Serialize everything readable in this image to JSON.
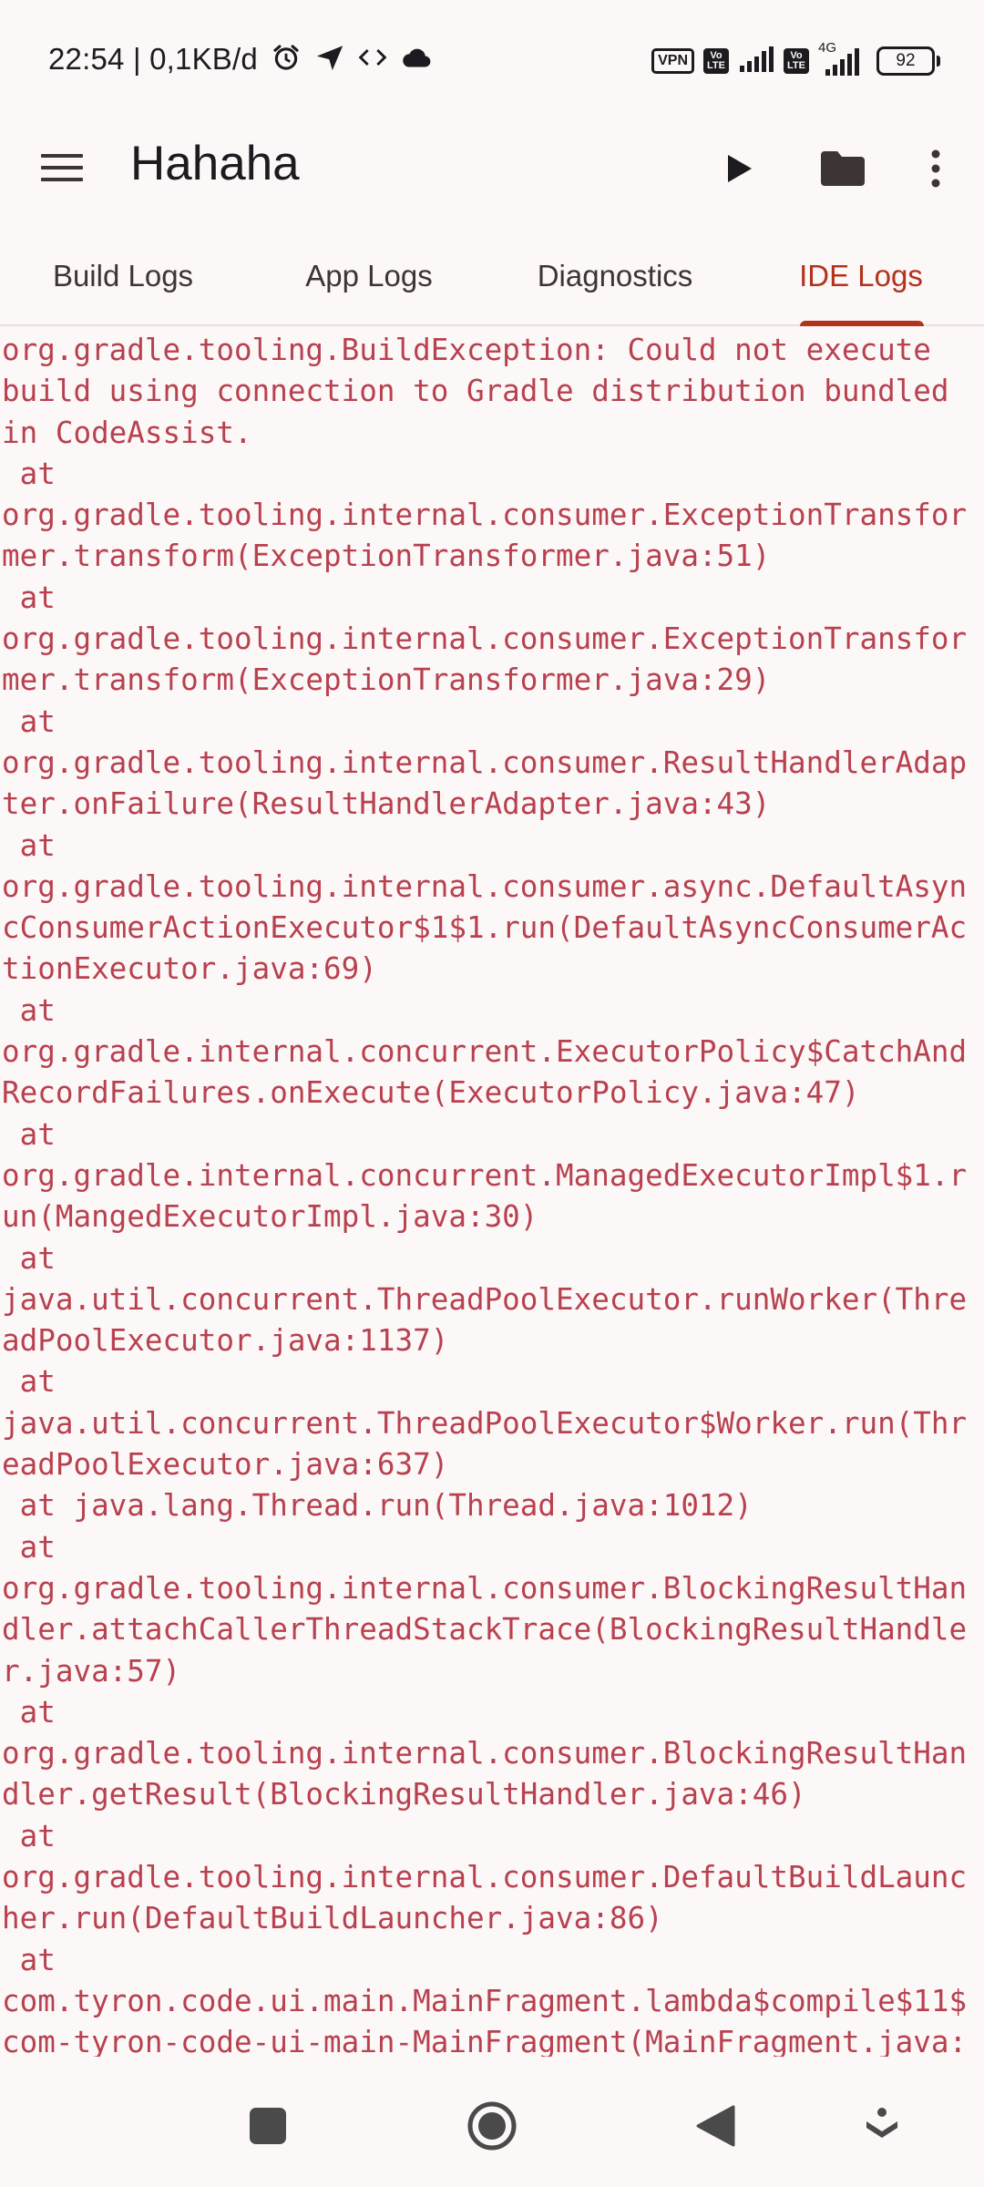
{
  "status_bar": {
    "time_text": "22:54 | 0,1KB/d",
    "vpn_label": "VPN",
    "volte_label": "Vo LTE",
    "network_label": "4G",
    "battery_level": "92"
  },
  "app_bar": {
    "title": "Hahaha"
  },
  "tabs": [
    {
      "label": "Build Logs",
      "active": false
    },
    {
      "label": "App Logs",
      "active": false
    },
    {
      "label": "Diagnostics",
      "active": false
    },
    {
      "label": "IDE Logs",
      "active": true
    }
  ],
  "log": {
    "lines": [
      "org.gradle.tooling.BuildException: Could not execute",
      "build using connection to Gradle distribution bundled",
      "in CodeAssist.",
      " at",
      "org.gradle.tooling.internal.consumer.ExceptionTransfor",
      "mer.transform(ExceptionTransformer.java:51)",
      " at",
      "org.gradle.tooling.internal.consumer.ExceptionTransfor",
      "mer.transform(ExceptionTransformer.java:29)",
      " at",
      "org.gradle.tooling.internal.consumer.ResultHandlerAdap",
      "ter.onFailure(ResultHandlerAdapter.java:43)",
      " at",
      "org.gradle.tooling.internal.consumer.async.DefaultAsyn",
      "cConsumerActionExecutor$1$1.run(DefaultAsyncConsumerAc",
      "tionExecutor.java:69)",
      " at",
      "org.gradle.internal.concurrent.ExecutorPolicy$CatchAnd",
      "RecordFailures.onExecute(ExecutorPolicy.java:47)",
      " at",
      "org.gradle.internal.concurrent.ManagedExecutorImpl$1.r",
      "un(MangedExecutorImpl.java:30)",
      " at",
      "java.util.concurrent.ThreadPoolExecutor.runWorker(Thre",
      "adPoolExecutor.java:1137)",
      " at",
      "java.util.concurrent.ThreadPoolExecutor$Worker.run(Thr",
      "eadPoolExecutor.java:637)",
      " at java.lang.Thread.run(Thread.java:1012)",
      " at",
      "org.gradle.tooling.internal.consumer.BlockingResultHan",
      "dler.attachCallerThreadStackTrace(BlockingResultHandle",
      "r.java:57)",
      " at",
      "org.gradle.tooling.internal.consumer.BlockingResultHan",
      "dler.getResult(BlockingResultHandler.java:46)",
      " at",
      "org.gradle.tooling.internal.consumer.DefaultBuildLaunc",
      "her.run(DefaultBuildLauncher.java:86)",
      " at",
      "com.tyron.code.ui.main.MainFragment.lambda$compile$11$",
      "com-tyron-code-ui-main-MainFragment(MainFragment.java:"
    ]
  },
  "colors": {
    "accent": "#b3321c",
    "log_text": "#b8414f",
    "background": "#fcf8f8",
    "on_surface": "#1c1b1f"
  },
  "icons": {
    "menu": "hamburger-menu-icon",
    "run": "play-icon",
    "folder": "folder-icon",
    "more": "more-vert-icon",
    "nav_recents": "square-recents-icon",
    "nav_home": "circle-home-icon",
    "nav_back": "triangle-back-icon",
    "nav_assist": "assistant-icon"
  }
}
